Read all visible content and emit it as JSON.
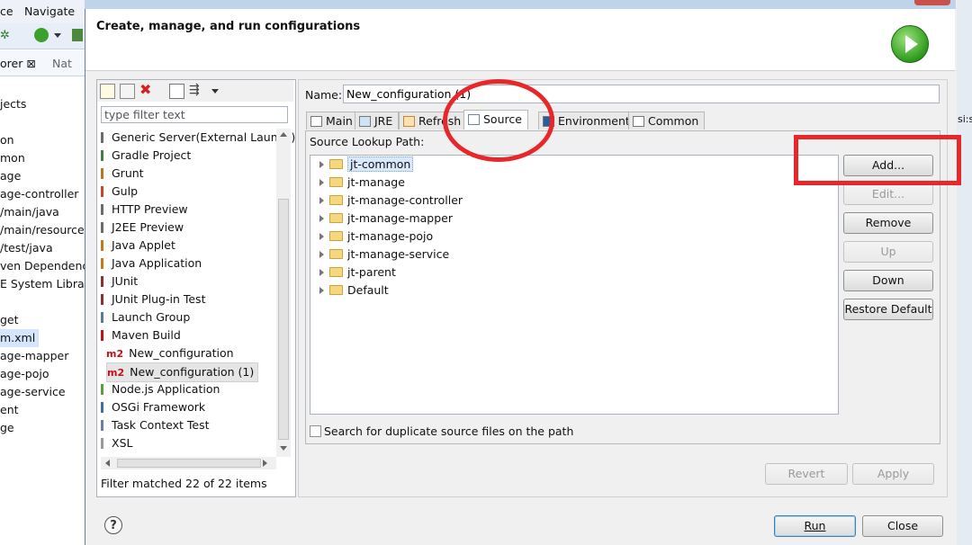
{
  "background": {
    "menu": [
      "ce",
      "Navigate"
    ],
    "tabs": [
      "orer ⊠",
      "Nat"
    ],
    "tree": [
      "jects",
      "on",
      "mon",
      "age",
      "age-controller",
      "/main/java",
      "/main/resources",
      "/test/java",
      "ven Dependencie",
      "E System Library",
      "get",
      "m.xml",
      "age-mapper",
      "age-pojo",
      "age-service",
      "ent",
      "ge"
    ],
    "right_hint": "si:s"
  },
  "dialog": {
    "heading": "Create, manage, and run configurations",
    "filter_placeholder": "type filter text",
    "config_types": [
      {
        "label": "Generic Server(External Launch)",
        "icon": "server-icon"
      },
      {
        "label": "Gradle Project",
        "icon": "gradle-icon"
      },
      {
        "label": "Grunt",
        "icon": "grunt-icon"
      },
      {
        "label": "Gulp",
        "icon": "gulp-icon"
      },
      {
        "label": "HTTP Preview",
        "icon": "http-preview-icon"
      },
      {
        "label": "J2EE Preview",
        "icon": "j2ee-preview-icon"
      },
      {
        "label": "Java Applet",
        "icon": "java-applet-icon"
      },
      {
        "label": "Java Application",
        "icon": "java-application-icon"
      },
      {
        "label": "JUnit",
        "icon": "junit-icon"
      },
      {
        "label": "JUnit Plug-in Test",
        "icon": "junit-plugin-icon"
      },
      {
        "label": "Launch Group",
        "icon": "launch-group-icon"
      },
      {
        "label": "Maven Build",
        "icon": "maven-icon"
      },
      {
        "label": "New_configuration",
        "icon": "m2-icon",
        "child": true
      },
      {
        "label": "New_configuration (1)",
        "icon": "m2-icon",
        "child": true,
        "selected": true
      },
      {
        "label": "Node.js Application",
        "icon": "nodejs-icon"
      },
      {
        "label": "OSGi Framework",
        "icon": "osgi-icon"
      },
      {
        "label": "Task Context Test",
        "icon": "task-context-icon"
      },
      {
        "label": "XSL",
        "icon": "xsl-icon"
      }
    ],
    "m2_badge": "m2",
    "filter_status": "Filter matched 22 of 22 items",
    "name_label": "Name:",
    "name_value": "New_configuration (1)",
    "tabs": [
      {
        "label": "Main"
      },
      {
        "label": "JRE"
      },
      {
        "label": "Refresh"
      },
      {
        "label": "Source",
        "active": true
      },
      {
        "label": "Environment"
      },
      {
        "label": "Common"
      }
    ],
    "lookup_label": "Source Lookup Path:",
    "source_entries": [
      "jt-common",
      "jt-manage",
      "jt-manage-controller",
      "jt-manage-mapper",
      "jt-manage-pojo",
      "jt-manage-service",
      "jt-parent",
      "Default"
    ],
    "side_buttons": [
      {
        "label": "Add...",
        "enabled": true
      },
      {
        "label": "Edit...",
        "enabled": false
      },
      {
        "label": "Remove",
        "enabled": true
      },
      {
        "label": "Up",
        "enabled": false
      },
      {
        "label": "Down",
        "enabled": true
      },
      {
        "label": "Restore Default",
        "enabled": true
      }
    ],
    "duplicate_check_label": "Search for duplicate source files on the path",
    "duplicate_checked": false,
    "revert_label": "Revert",
    "apply_label": "Apply",
    "run_label": "Run",
    "close_label": "Close",
    "help_glyph": "?"
  },
  "colors": {
    "annotation_red": "#e8272b",
    "run_green": "#2f9a1e"
  }
}
